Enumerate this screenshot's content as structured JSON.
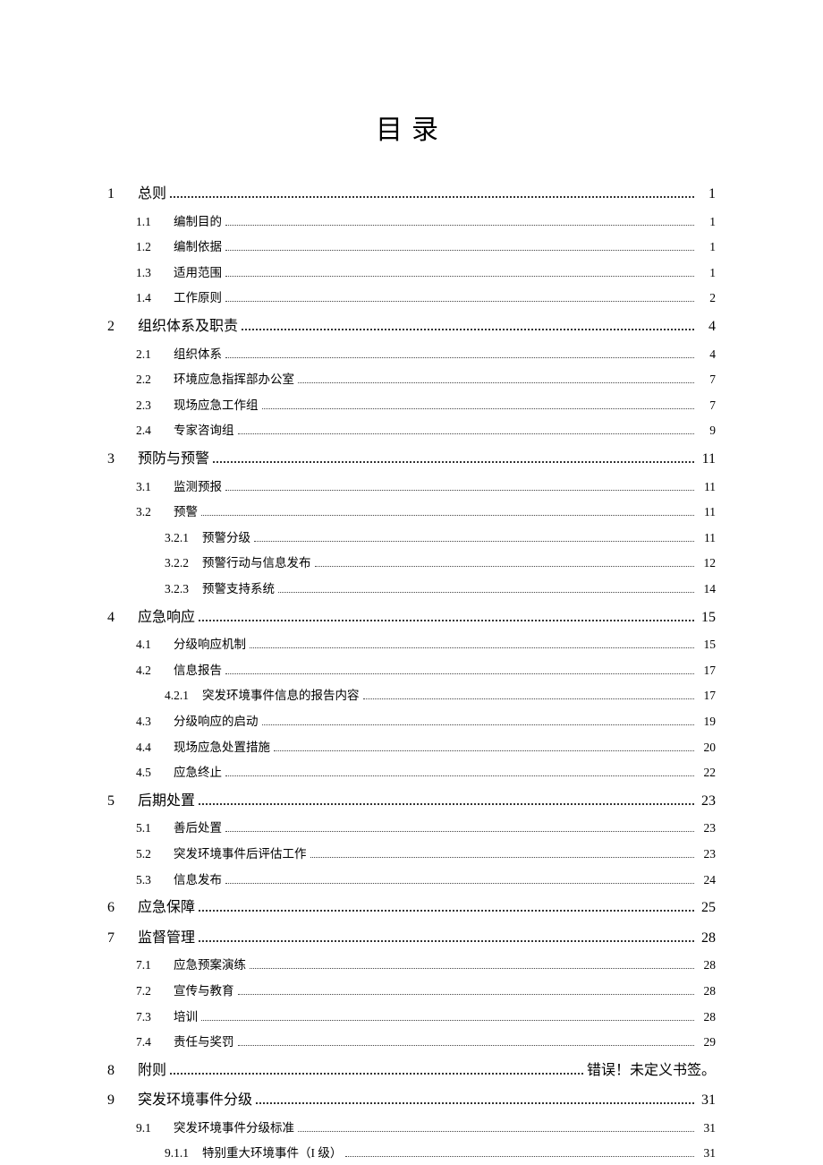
{
  "title": "目录",
  "entries": [
    {
      "level": 0,
      "num": "1",
      "text": "总则",
      "page": "1"
    },
    {
      "level": 1,
      "num": "1.1",
      "text": "编制目的",
      "page": "1"
    },
    {
      "level": 1,
      "num": "1.2",
      "text": "编制依据",
      "page": "1"
    },
    {
      "level": 1,
      "num": "1.3",
      "text": "适用范围",
      "page": "1"
    },
    {
      "level": 1,
      "num": "1.4",
      "text": "工作原则",
      "page": "2"
    },
    {
      "level": 0,
      "num": "2",
      "text": "组织体系及职责",
      "page": "4"
    },
    {
      "level": 1,
      "num": "2.1",
      "text": "组织体系",
      "page": "4"
    },
    {
      "level": 1,
      "num": "2.2",
      "text": "环境应急指挥部办公室",
      "page": "7"
    },
    {
      "level": 1,
      "num": "2.3",
      "text": "现场应急工作组",
      "page": "7"
    },
    {
      "level": 1,
      "num": "2.4",
      "text": "专家咨询组",
      "page": "9"
    },
    {
      "level": 0,
      "num": "3",
      "text": "预防与预警",
      "page": "11"
    },
    {
      "level": 1,
      "num": "3.1",
      "text": "监测预报",
      "page": "11"
    },
    {
      "level": 1,
      "num": "3.2",
      "text": "预警",
      "page": "11"
    },
    {
      "level": 2,
      "num": "3.2.1",
      "text": "预警分级",
      "page": "11"
    },
    {
      "level": 2,
      "num": "3.2.2",
      "text": "预警行动与信息发布",
      "page": "12"
    },
    {
      "level": 2,
      "num": "3.2.3",
      "text": "预警支持系统",
      "page": "14"
    },
    {
      "level": 0,
      "num": "4",
      "text": "应急响应",
      "page": "15"
    },
    {
      "level": 1,
      "num": "4.1",
      "text": "分级响应机制",
      "page": "15"
    },
    {
      "level": 1,
      "num": "4.2",
      "text": "信息报告",
      "page": "17"
    },
    {
      "level": 2,
      "num": "4.2.1",
      "text": "突发环境事件信息的报告内容",
      "page": "17"
    },
    {
      "level": 1,
      "num": "4.3",
      "text": "分级响应的启动",
      "page": "19"
    },
    {
      "level": 1,
      "num": "4.4",
      "text": "现场应急处置措施",
      "page": "20"
    },
    {
      "level": 1,
      "num": "4.5",
      "text": "应急终止",
      "page": "22"
    },
    {
      "level": 0,
      "num": "5",
      "text": "后期处置",
      "page": "23"
    },
    {
      "level": 1,
      "num": "5.1",
      "text": "善后处置",
      "page": "23"
    },
    {
      "level": 1,
      "num": "5.2",
      "text": "突发环境事件后评估工作",
      "page": "23"
    },
    {
      "level": 1,
      "num": "5.3",
      "text": "信息发布",
      "page": "24"
    },
    {
      "level": 0,
      "num": "6",
      "text": "应急保障",
      "page": "25"
    },
    {
      "level": 0,
      "num": "7",
      "text": "监督管理",
      "page": "28"
    },
    {
      "level": 1,
      "num": "7.1",
      "text": "应急预案演练",
      "page": "28"
    },
    {
      "level": 1,
      "num": "7.2",
      "text": "宣传与教育",
      "page": "28"
    },
    {
      "level": 1,
      "num": "7.3",
      "text": "培训",
      "page": "28"
    },
    {
      "level": 1,
      "num": "7.4",
      "text": "责任与奖罚",
      "page": "29"
    },
    {
      "level": 0,
      "num": "8",
      "text": "附则",
      "page": "错误！未定义书签。"
    },
    {
      "level": 0,
      "num": "9",
      "text": "突发环境事件分级",
      "page": "31"
    },
    {
      "level": 1,
      "num": "9.1",
      "text": "突发环境事件分级标准",
      "page": "31"
    },
    {
      "level": 2,
      "num": "9.1.1",
      "text": "特别重大环境事件（I 级）",
      "page": "31"
    }
  ]
}
